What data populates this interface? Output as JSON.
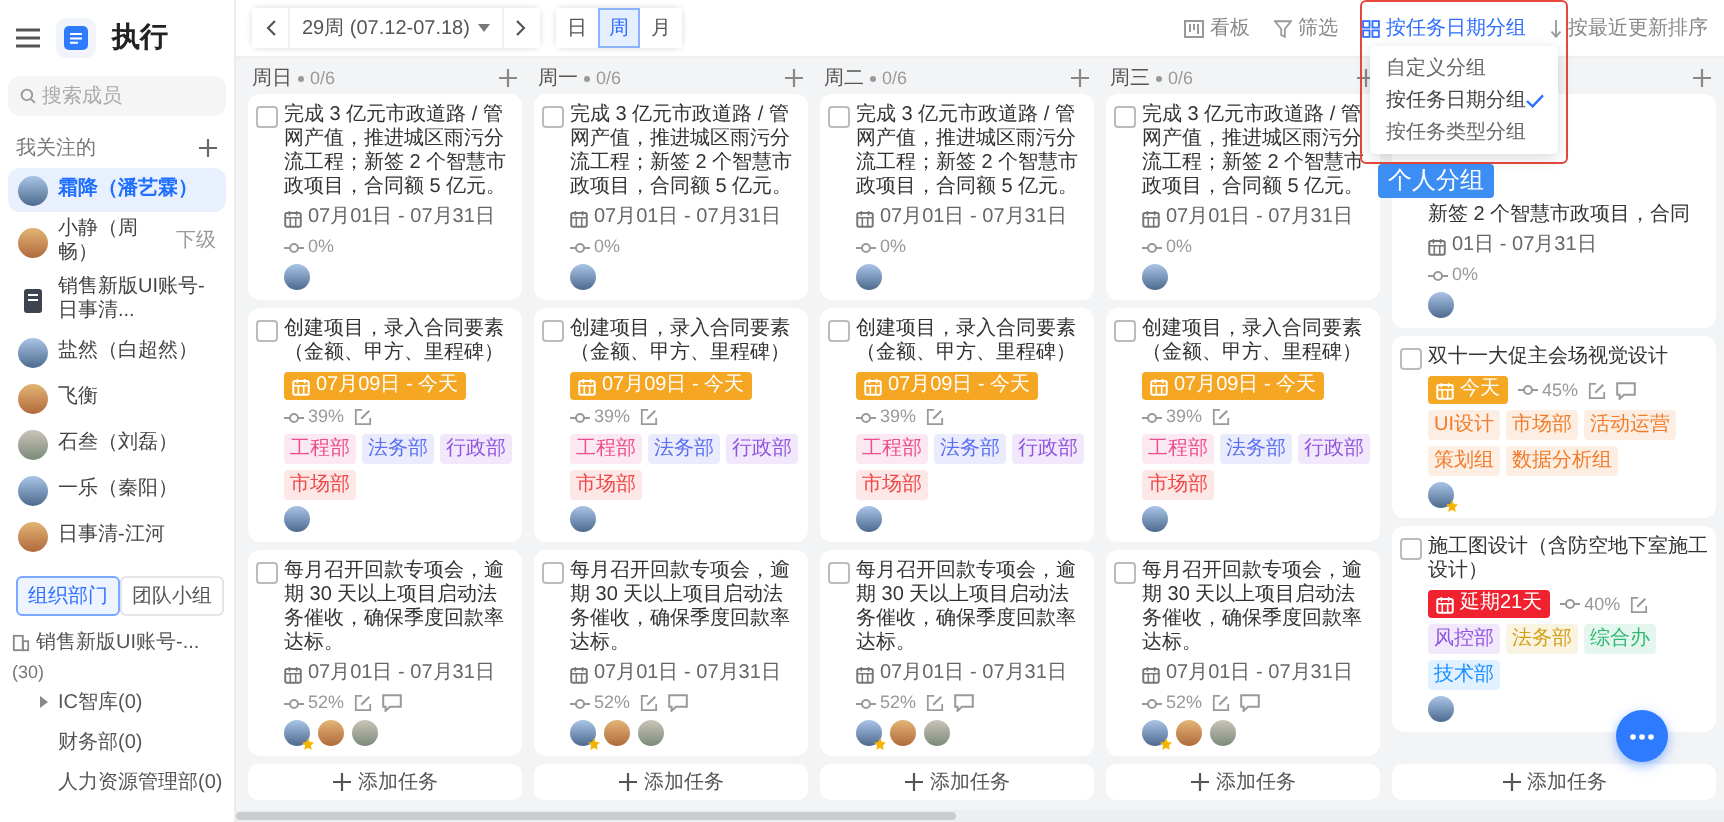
{
  "sidebar": {
    "app_title": "执行",
    "search": {
      "placeholder": "搜索成员"
    },
    "section_title": "我关注的",
    "people": [
      {
        "name": "霜降（潘艺霖）",
        "kind": "person",
        "selected": true
      },
      {
        "name": "小静（周畅）",
        "kind": "person",
        "selected": false,
        "tag": "下级"
      },
      {
        "name": "销售新版UI账号-日事清...",
        "kind": "org",
        "selected": false
      },
      {
        "name": "盐然（白超然）",
        "kind": "person",
        "selected": false
      },
      {
        "name": "飞衡",
        "kind": "person",
        "selected": false
      },
      {
        "name": "石叁（刘磊）",
        "kind": "person",
        "selected": false
      },
      {
        "name": "一乐（秦阳）",
        "kind": "person",
        "selected": false
      },
      {
        "name": "日事清-江河",
        "kind": "person",
        "selected": false
      }
    ],
    "tabs": [
      {
        "label": "组织部门",
        "selected": true
      },
      {
        "label": "团队小组",
        "selected": false
      }
    ],
    "tree": [
      {
        "label": "销售新版UI账号-...",
        "count": "(30)",
        "children": [
          {
            "label": "IC智库(0)",
            "has_children": true
          },
          {
            "label": "财务部(0)",
            "has_children": false
          },
          {
            "label": "人力资源管理部(0)",
            "has_children": false
          }
        ]
      }
    ]
  },
  "toolbar": {
    "week": "29周 (07.12-07.18)",
    "views": [
      {
        "label": "日",
        "selected": false
      },
      {
        "label": "周",
        "selected": true
      },
      {
        "label": "月",
        "selected": false
      }
    ],
    "actions": [
      {
        "label": "看板",
        "kind": "board",
        "active": false
      },
      {
        "label": "筛选",
        "kind": "filter",
        "active": false
      },
      {
        "label": "按任务日期分组",
        "kind": "group",
        "active": true
      },
      {
        "label": "按最近更新排序",
        "kind": "sort",
        "active": false
      }
    ]
  },
  "group_menu": {
    "items": [
      {
        "label": "自定义分组",
        "selected": false
      },
      {
        "label": "按任务日期分组",
        "selected": true
      },
      {
        "label": "按任务类型分组",
        "selected": false
      }
    ]
  },
  "callout": "个人分组",
  "columns": [
    {
      "title": "周日",
      "count": "0/6",
      "add_label": "添加任务",
      "cards": [
        {
          "kind": "task",
          "title": "完成 3 亿元市政道路 / 管网产值，推进城区雨污分流工程；新签 2 个智慧市政项目，合同额 5 亿元。",
          "done": false,
          "date": {
            "text": "07月01日 - 07月31日",
            "kind": "range"
          },
          "progress": "0%",
          "edit": false,
          "comment": false,
          "avatars": [
            {
              "star": false
            }
          ]
        },
        {
          "kind": "task",
          "title": "创建项目，录入合同要素（金额、甲方、里程碑）",
          "done": false,
          "date": {
            "text": "07月09日 - 今天",
            "kind": "today"
          },
          "progress": "39%",
          "edit": true,
          "comment": false,
          "tags": [
            {
              "label": "工程部",
              "color": "#eb4d8f"
            },
            {
              "label": "法务部",
              "color": "#5a6ff0"
            },
            {
              "label": "行政部",
              "color": "#9254de"
            },
            {
              "label": "市场部",
              "color": "#f04848"
            }
          ],
          "avatars": [
            {
              "star": false
            }
          ]
        },
        {
          "kind": "task",
          "title": "每月召开回款专项会，逾期 30 天以上项目启动法务催收，确保季度回款率达标。",
          "done": false,
          "date": {
            "text": "07月01日 - 07月31日",
            "kind": "range"
          },
          "progress": "52%",
          "edit": true,
          "comment": true,
          "avatars": [
            {
              "star": true
            },
            {
              "star": false
            },
            {
              "star": false
            }
          ]
        }
      ]
    },
    {
      "title": "周一",
      "count": "0/6",
      "add_label": "添加任务",
      "cards": [
        {
          "kind": "task",
          "title": "完成 3 亿元市政道路 / 管网产值，推进城区雨污分流工程；新签 2 个智慧市政项目，合同额 5 亿元。",
          "done": false,
          "date": {
            "text": "07月01日 - 07月31日",
            "kind": "range"
          },
          "progress": "0%",
          "edit": false,
          "comment": false,
          "avatars": [
            {
              "star": false
            }
          ]
        },
        {
          "kind": "task",
          "title": "创建项目，录入合同要素（金额、甲方、里程碑）",
          "done": false,
          "date": {
            "text": "07月09日 - 今天",
            "kind": "today"
          },
          "progress": "39%",
          "edit": true,
          "comment": false,
          "tags": [
            {
              "label": "工程部",
              "color": "#eb4d8f"
            },
            {
              "label": "法务部",
              "color": "#5a6ff0"
            },
            {
              "label": "行政部",
              "color": "#9254de"
            },
            {
              "label": "市场部",
              "color": "#f04848"
            }
          ],
          "avatars": [
            {
              "star": false
            }
          ]
        },
        {
          "kind": "task",
          "title": "每月召开回款专项会，逾期 30 天以上项目启动法务催收，确保季度回款率达标。",
          "done": false,
          "date": {
            "text": "07月01日 - 07月31日",
            "kind": "range"
          },
          "progress": "52%",
          "edit": true,
          "comment": true,
          "avatars": [
            {
              "star": true
            },
            {
              "star": false
            },
            {
              "star": false
            }
          ]
        }
      ]
    },
    {
      "title": "周二",
      "count": "0/6",
      "add_label": "添加任务",
      "cards": [
        {
          "kind": "task",
          "title": "完成 3 亿元市政道路 / 管网产值，推进城区雨污分流工程；新签 2 个智慧市政项目，合同额 5 亿元。",
          "done": false,
          "date": {
            "text": "07月01日 - 07月31日",
            "kind": "range"
          },
          "progress": "0%",
          "edit": false,
          "comment": false,
          "avatars": [
            {
              "star": false
            }
          ]
        },
        {
          "kind": "task",
          "title": "创建项目，录入合同要素（金额、甲方、里程碑）",
          "done": false,
          "date": {
            "text": "07月09日 - 今天",
            "kind": "today"
          },
          "progress": "39%",
          "edit": true,
          "comment": false,
          "tags": [
            {
              "label": "工程部",
              "color": "#eb4d8f"
            },
            {
              "label": "法务部",
              "color": "#5a6ff0"
            },
            {
              "label": "行政部",
              "color": "#9254de"
            },
            {
              "label": "市场部",
              "color": "#f04848"
            }
          ],
          "avatars": [
            {
              "star": false
            }
          ]
        },
        {
          "kind": "task",
          "title": "每月召开回款专项会，逾期 30 天以上项目启动法务催收，确保季度回款率达标。",
          "done": false,
          "date": {
            "text": "07月01日 - 07月31日",
            "kind": "range"
          },
          "progress": "52%",
          "edit": true,
          "comment": true,
          "avatars": [
            {
              "star": true
            },
            {
              "star": false
            },
            {
              "star": false
            }
          ]
        }
      ]
    },
    {
      "title": "周三",
      "count": "0/6",
      "add_label": "添加任务",
      "cards": [
        {
          "kind": "task",
          "title": "完成 3 亿元市政道路 / 管网产值，推进城区雨污分流工程；新签 2 个智慧市政项目，合同额 5 亿元。",
          "done": false,
          "date": {
            "text": "07月01日 - 07月31日",
            "kind": "range"
          },
          "progress": "0%",
          "edit": false,
          "comment": false,
          "avatars": [
            {
              "star": false
            }
          ]
        },
        {
          "kind": "task",
          "title": "创建项目，录入合同要素（金额、甲方、里程碑）",
          "done": false,
          "date": {
            "text": "07月09日 - 今天",
            "kind": "today"
          },
          "progress": "39%",
          "edit": true,
          "comment": false,
          "tags": [
            {
              "label": "工程部",
              "color": "#eb4d8f"
            },
            {
              "label": "法务部",
              "color": "#5a6ff0"
            },
            {
              "label": "行政部",
              "color": "#9254de"
            },
            {
              "label": "市场部",
              "color": "#f04848"
            }
          ],
          "avatars": [
            {
              "star": false
            }
          ]
        },
        {
          "kind": "task",
          "title": "每月召开回款专项会，逾期 30 天以上项目启动法务催收，确保季度回款率达标。",
          "done": false,
          "date": {
            "text": "07月01日 - 07月31日",
            "kind": "range"
          },
          "progress": "52%",
          "edit": true,
          "comment": true,
          "avatars": [
            {
              "star": true
            },
            {
              "star": false
            },
            {
              "star": false
            }
          ]
        }
      ]
    },
    {
      "add_label": "添加任务",
      "cards": [
        {
          "kind": "partial",
          "title": "新签 2 个智慧市政项目，合同",
          "date": {
            "text": "01日 - 07月31日",
            "kind": "range"
          },
          "progress": "0%",
          "edit": false,
          "comment": false,
          "avatars": [
            {
              "star": false
            }
          ]
        },
        {
          "kind": "task",
          "title": "双十一大促主会场视觉设计",
          "done": false,
          "date": {
            "text": "今天",
            "kind": "today"
          },
          "progress": "45%",
          "edit": true,
          "comment": true,
          "tags": [
            {
              "label": "UI设计",
              "color": "#f07c2a"
            },
            {
              "label": "市场部",
              "color": "#f07c2a"
            },
            {
              "label": "活动运营",
              "color": "#f07c2a"
            },
            {
              "label": "策划组",
              "color": "#f07c2a"
            },
            {
              "label": "数据分析组",
              "color": "#f07c2a"
            }
          ],
          "avatars": [
            {
              "star": true
            }
          ]
        },
        {
          "kind": "task",
          "title": "施工图设计（含防空地下室施工设计）",
          "done": false,
          "date": {
            "text": "延期21天",
            "kind": "overdue"
          },
          "progress": "40%",
          "edit": true,
          "comment": false,
          "tags": [
            {
              "label": "风控部",
              "color": "#9254de"
            },
            {
              "label": "法务部",
              "color": "#d4a017"
            },
            {
              "label": "综合办",
              "color": "#2eb872"
            },
            {
              "label": "技术部",
              "color": "#1890ff"
            }
          ],
          "avatars": [
            {
              "star": false
            }
          ]
        }
      ]
    }
  ]
}
